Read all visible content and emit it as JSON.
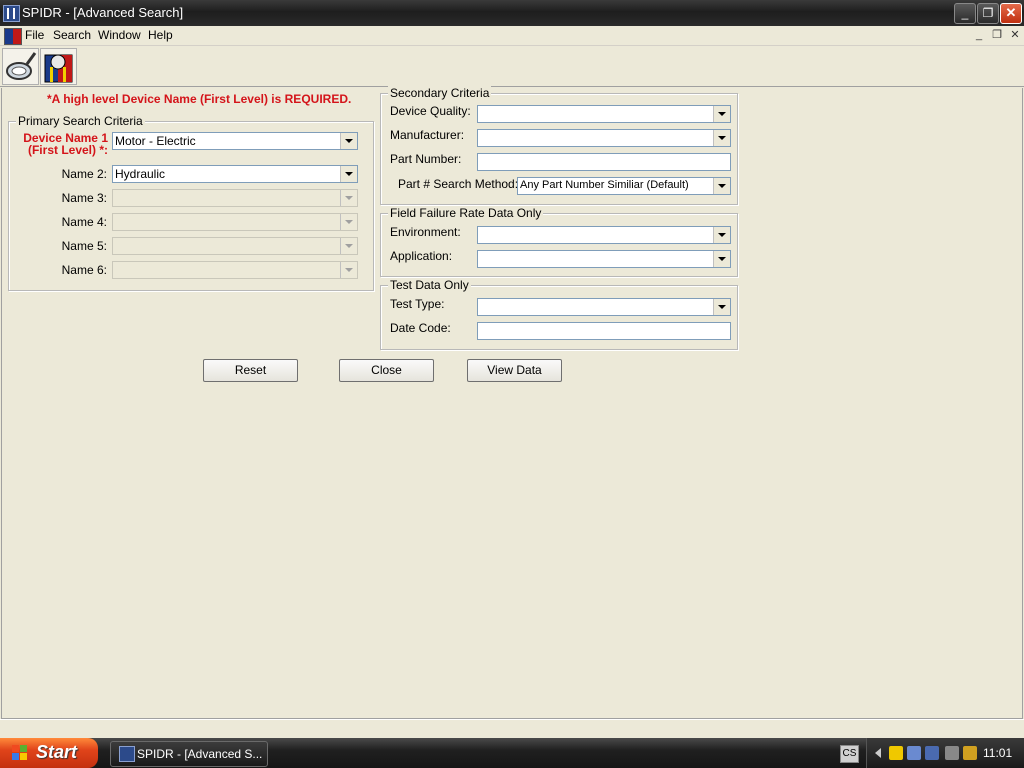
{
  "window": {
    "title": "SPIDR - [Advanced Search]",
    "controls": {
      "minimize": "_",
      "restore": "❐",
      "close": "✕"
    }
  },
  "menu": {
    "items": [
      "File",
      "Search",
      "Window",
      "Help"
    ],
    "mdi_controls": {
      "minimize": "_",
      "restore": "❐",
      "close": "✕"
    }
  },
  "toolbar": {
    "tools": [
      {
        "icon": "search-lens-icon"
      },
      {
        "icon": "spidr-report-icon"
      }
    ]
  },
  "form": {
    "required_note": "*A high level Device Name (First Level) is REQUIRED.",
    "primary": {
      "legend": "Primary Search Criteria",
      "device_name_1_label_line1": "Device Name 1",
      "device_name_1_label_line2": "(First Level) *:",
      "device_name_1_value": "Motor - Electric",
      "name2_label": "Name 2:",
      "name2_value": "Hydraulic",
      "name3_label": "Name 3:",
      "name4_label": "Name 4:",
      "name5_label": "Name 5:",
      "name6_label": "Name 6:"
    },
    "secondary": {
      "legend": "Secondary Criteria",
      "device_quality_label": "Device Quality:",
      "manufacturer_label": "Manufacturer:",
      "part_number_label": "Part Number:",
      "search_method_label": "Part # Search Method:",
      "search_method_value": "Any Part Number Similiar (Default)"
    },
    "field_failure": {
      "legend": "Field Failure Rate Data Only",
      "environment_label": "Environment:",
      "application_label": "Application:"
    },
    "test_data": {
      "legend": "Test Data Only",
      "test_type_label": "Test Type:",
      "date_code_label": "Date Code:"
    },
    "buttons": {
      "reset": "Reset",
      "close": "Close",
      "view_data": "View Data"
    }
  },
  "taskbar": {
    "start_label": "Start",
    "task_label": "SPIDR - [Advanced S...",
    "language": "CS",
    "clock": "11:01"
  }
}
